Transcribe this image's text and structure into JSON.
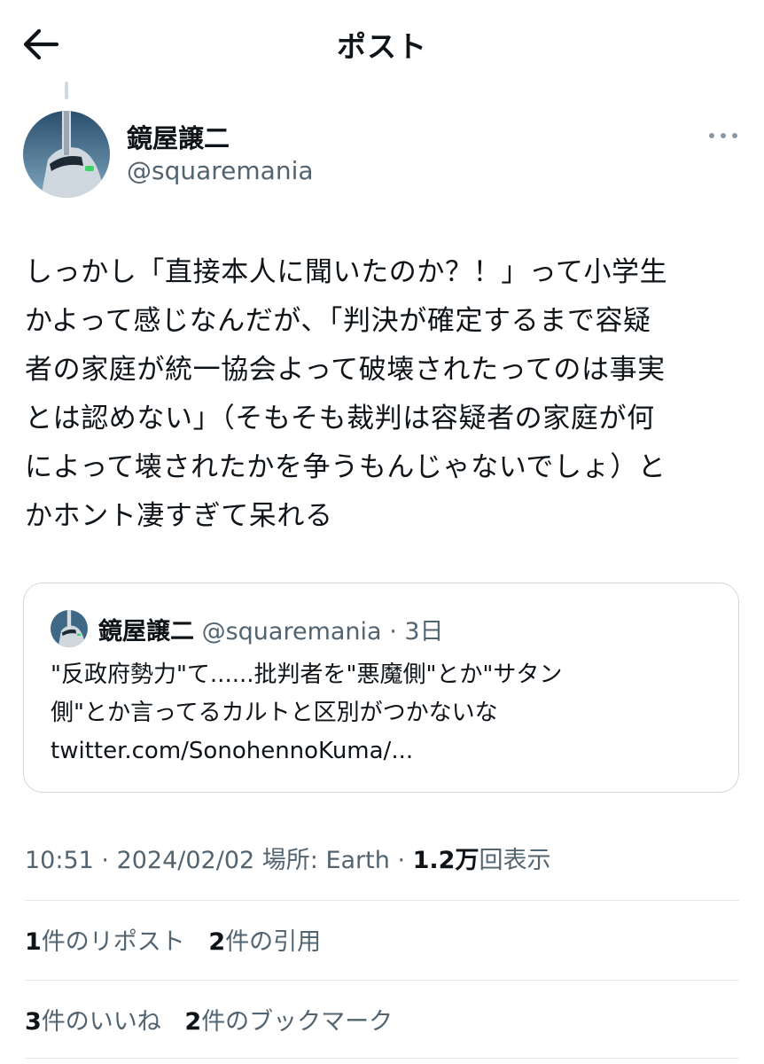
{
  "header": {
    "title": "ポスト",
    "back_icon": "arrow-left-icon"
  },
  "post": {
    "author_name": "鏡屋譲二",
    "author_handle": "@squaremania",
    "more_icon": "more-horizontal-icon",
    "lines": [
      "しっかし「直接本人に聞いたのか？！」って小学生",
      "かよって感じなんだが、「判決が確定するまで容疑",
      "者の家庭が統一協会よって破壊されたってのは事実",
      "とは認めない」（そもそも裁判は容疑者の家庭が何",
      "によって壊されたかを争うもんじゃないでしょ）と",
      "かホント凄すぎて呆れる"
    ]
  },
  "quote": {
    "author_name": "鏡屋譲二",
    "author_handle": "@squaremania",
    "separator": "·",
    "age": "3日",
    "lines": [
      "\"反政府勢力\"て......批判者を\"悪魔側\"とか\"サタン",
      "側\"とか言ってるカルトと区別がつかないな",
      "twitter.com/SonohennoKuma/..."
    ]
  },
  "meta": {
    "time": "10:51",
    "sep1": " · ",
    "date": "2024/02/02",
    "location": " 場所: Earth",
    "sep2": " · ",
    "views_count": "1.2万",
    "views_label": "回表示"
  },
  "stats_row1": [
    {
      "count": "1",
      "label": "件のリポスト"
    },
    {
      "count": "2",
      "label": "件の引用"
    }
  ],
  "stats_row2": [
    {
      "count": "3",
      "label": "件のいいね"
    },
    {
      "count": "2",
      "label": "件のブックマーク"
    }
  ],
  "colors": {
    "text": "#0f1419",
    "secondary": "#536471",
    "border": "#cfd9de"
  }
}
